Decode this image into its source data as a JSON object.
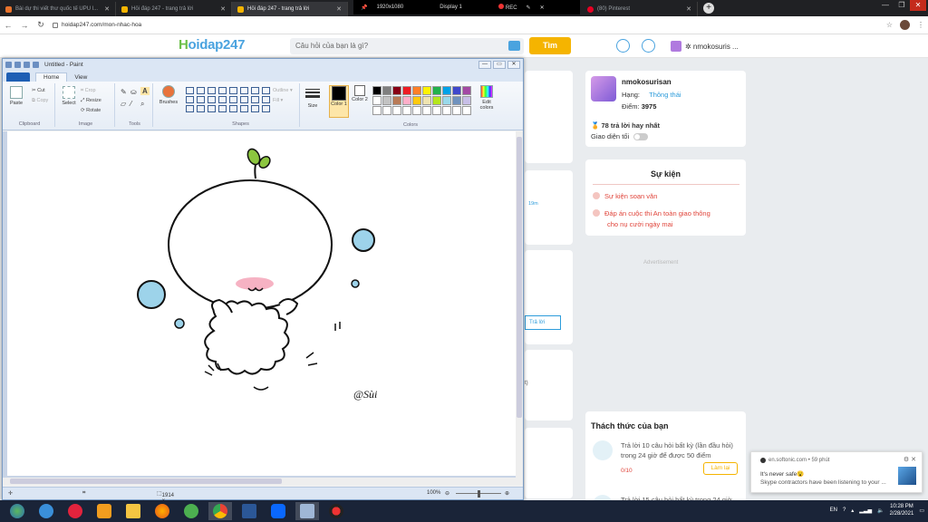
{
  "browser": {
    "tabs": [
      {
        "title": "Bài dự thi viết thư quốc tế UPU l...",
        "color": "#e8732c"
      },
      {
        "title": "Hỏi đáp 247 - trang trả lời",
        "color": "#f5b400"
      },
      {
        "title": "Hỏi đáp 247 - trang trả lời",
        "color": "#f5b400"
      }
    ],
    "rec_resolution": "1920x1080",
    "rec_display": "Display 1",
    "rec_label": "REC",
    "pinterest_tab": "(80) Pinterest",
    "url": "hoidap247.com/mon-nhac-hoa"
  },
  "site": {
    "logo_h": "H",
    "logo_rest": "oidap247",
    "search_placeholder": "Câu hỏi của bạn là gì?",
    "search_button": "Tìm",
    "username_short": "✲ nmokosuris ..."
  },
  "profile": {
    "name": "nmokosurisan",
    "rank_label": "Hạng:",
    "rank_value": "Thông thái",
    "points_label": "Điểm:",
    "points_value": "3975",
    "best_answers": "78 trả lời hay nhất",
    "dark_mode_label": "Giao diện tối"
  },
  "events": {
    "title": "Sự kiện",
    "items": [
      "Sự kiện soạn văn",
      "Đáp án cuộc thi An toàn giao thông",
      "cho nụ cười ngày mai"
    ]
  },
  "advertisement": "Advertisement",
  "partial": {
    "time": "19m",
    "reply": "Trả lời",
    "paren": "t)"
  },
  "challenges": {
    "title": "Thách thức của bạn",
    "items": [
      {
        "text1": "Trả lời 10 câu hỏi  bất kỳ (lần đầu hỏi)",
        "text2": "trong 24 giờ để được 50 điểm",
        "progress": "0/10",
        "button": "Làm lại"
      },
      {
        "text1": "Trả lời 15 câu hỏi  bất kỳ  trong 24 giờ"
      }
    ]
  },
  "paint": {
    "title": "Untitled - Paint",
    "tabs": [
      "Home",
      "View"
    ],
    "groups": [
      "Clipboard",
      "Image",
      "Tools",
      "Shapes",
      "Colors"
    ],
    "buttons": {
      "paste": "Paste",
      "cut": "Cut",
      "copy": "Copy",
      "select": "Select",
      "crop": "Crop",
      "resize": "Resize",
      "rotate": "Rotate",
      "brushes": "Brushes",
      "outline": "Outline ▾",
      "fill": "Fill ▾",
      "size": "Size",
      "color1": "Color 1",
      "color2": "Color 2",
      "edit_colors": "Edit colors"
    },
    "palette": [
      "#000000",
      "#7f7f7f",
      "#880015",
      "#ed1c24",
      "#ff7f27",
      "#fff200",
      "#22b14c",
      "#00a2e8",
      "#3f48cc",
      "#a349a4",
      "#ffffff",
      "#c3c3c3",
      "#b97a57",
      "#ffaec9",
      "#ffc90e",
      "#efe4b0",
      "#b5e61d",
      "#99d9ea",
      "#7092be",
      "#c8bfe7",
      "#ffffff",
      "#ffffff",
      "#ffffff",
      "#ffffff",
      "#ffffff",
      "#ffffff",
      "#ffffff",
      "#ffffff",
      "#ffffff",
      "#ffffff"
    ],
    "signature": "@Sùi",
    "status_size": "1914 × 848px",
    "zoom": "100%"
  },
  "notification": {
    "source": "en.softonic.com  •  59 phút",
    "line1": "It's never safe😮",
    "line2": "Skype contractors have been listening to your ..."
  },
  "taskbar": {
    "lang": "EN",
    "time": "10:28 PM",
    "date": "2/28/2021"
  }
}
